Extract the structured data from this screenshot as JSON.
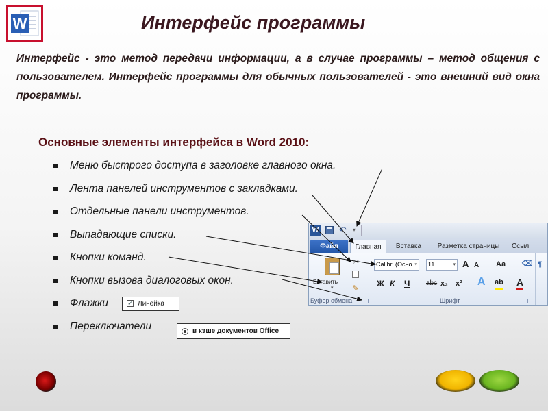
{
  "slide": {
    "title": "Интерфейс программы",
    "intro": "Интерфейс - это метод передачи информации, а в случае программы – метод общения с пользователем. Интерфейс программы для обычных пользователей - это внешний вид окна программы.",
    "subheading": "Основные элементы интерфейса в Word 2010:",
    "bullets": [
      "Меню быстрого доступа в заголовке главного окна.",
      "Лента панелей инструментов с закладками.",
      "Отдельные панели инструментов.",
      "Выпадающие списки.",
      "Кнопки команд.",
      "Кнопки вызова диалоговых окон.",
      "Флажки",
      "Переключатели"
    ],
    "checkbox_example": {
      "label": "Линейка",
      "checked": true
    },
    "radio_example": {
      "label": "в кэше документов Office",
      "selected": true
    }
  },
  "ribbon": {
    "app_icon": "W",
    "tabs": [
      "Файл",
      "Главная",
      "Вставка",
      "Разметка страницы",
      "Ссыл"
    ],
    "active_tab": "Главная",
    "clipboard": {
      "paste_label": "Вставить",
      "group_label": "Буфер обмена"
    },
    "font": {
      "font_name": "Calibri (Осно",
      "font_size": "11",
      "grow_label": "A",
      "shrink_label": "A",
      "case_label": "Aa",
      "bold": "Ж",
      "italic": "К",
      "underline": "Ч",
      "strike": "abc",
      "subscript": "x₂",
      "superscript": "x²",
      "group_label": "Шрифт"
    }
  },
  "colors": {
    "title": "#3b1820",
    "subheading": "#5a1116",
    "file_tab": "#2356a8",
    "nav_red": "#d81818",
    "nav_yellow": "#f0b400",
    "nav_green": "#6ab520"
  }
}
